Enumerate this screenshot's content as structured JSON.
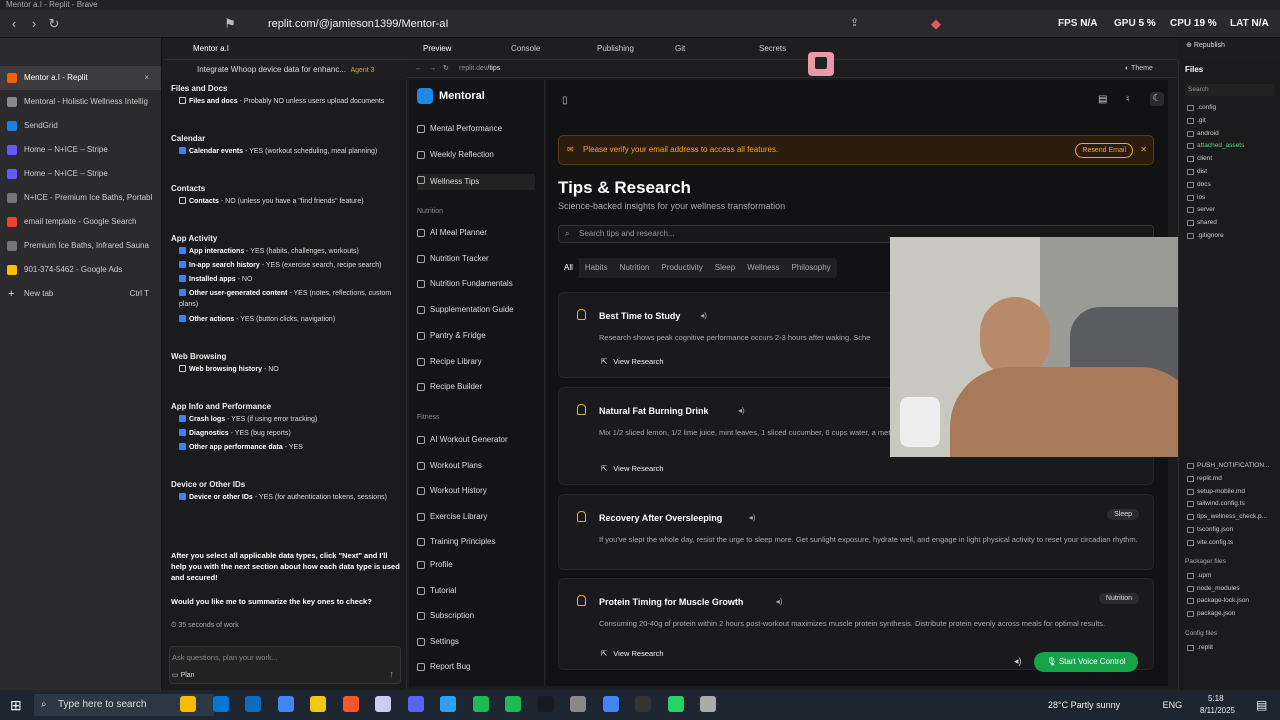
{
  "window": {
    "title": "Mentor a.I - Replit - Brave"
  },
  "browser": {
    "url": "replit.com/@jamieson1399/Mentor-aI",
    "stats": {
      "fps_label": "FPS",
      "fps": "N/A",
      "gpu_label": "GPU",
      "gpu": "5 %",
      "cpu_label": "CPU",
      "cpu": "19 %",
      "lat_label": "LAT",
      "lat": "N/A"
    }
  },
  "tabs": [
    {
      "label": "Mentor a.I - Replit",
      "color": "#f26207",
      "active": true
    },
    {
      "label": "Mentoral - Holistic Wellness Intellig",
      "color": "#888"
    },
    {
      "label": "SendGrid",
      "color": "#1a82e2"
    },
    {
      "label": "Home – N+ICE – Stripe",
      "color": "#635bff"
    },
    {
      "label": "Home – N+ICE – Stripe",
      "color": "#635bff"
    },
    {
      "label": "N+ICE - Premium Ice Baths, Portabl",
      "color": "#777"
    },
    {
      "label": "email template - Google Search",
      "color": "#ea4335"
    },
    {
      "label": "Premium Ice Baths, Infrared Sauna",
      "color": "#777"
    },
    {
      "label": "901-374-5462 - Google Ads",
      "color": "#fbbc04"
    }
  ],
  "new_tab": {
    "label": "New tab",
    "shortcut": "Ctrl T"
  },
  "chat": {
    "project": "Mentor a.I",
    "task": "Integrate Whoop device data for enhanc...",
    "agent": "Agent 3",
    "sections": [
      {
        "title": "Files and Docs",
        "items": [
          {
            "box": "empty",
            "bold": "Files and docs",
            "text": " - Probably NO unless users upload documents"
          }
        ]
      },
      {
        "title": "Calendar",
        "items": [
          {
            "box": "checked",
            "bold": "Calendar events",
            "text": " - YES (workout scheduling, meal planning)"
          }
        ]
      },
      {
        "title": "Contacts",
        "items": [
          {
            "box": "empty",
            "bold": "Contacts",
            "text": " - NO (unless you have a \"find friends\" feature)"
          }
        ]
      },
      {
        "title": "App Activity",
        "items": [
          {
            "box": "checked",
            "bold": "App interactions",
            "text": " - YES (habits, challenges, workouts)"
          },
          {
            "box": "checked",
            "bold": "In-app search history",
            "text": " - YES (exercise search, recipe search)"
          },
          {
            "box": "checked",
            "bold": "Installed apps",
            "text": " - NO"
          },
          {
            "box": "checked",
            "bold": "Other user-generated content",
            "text": " - YES (notes, reflections, custom plans)"
          },
          {
            "box": "checked",
            "bold": "Other actions",
            "text": " - YES (button clicks, navigation)"
          }
        ]
      },
      {
        "title": "Web Browsing",
        "items": [
          {
            "box": "empty",
            "bold": "Web browsing history",
            "text": " - NO"
          }
        ]
      },
      {
        "title": "App Info and Performance",
        "items": [
          {
            "box": "checked",
            "bold": "Crash logs",
            "text": " - YES (if using error tracking)"
          },
          {
            "box": "checked",
            "bold": "Diagnostics",
            "text": " - YES (bug reports)"
          },
          {
            "box": "checked",
            "bold": "Other app performance data",
            "text": " - YES"
          }
        ]
      },
      {
        "title": "Device or Other IDs",
        "items": [
          {
            "box": "checked",
            "bold": "Device or other IDs",
            "text": " - YES (for authentication tokens, sessions)"
          }
        ]
      }
    ],
    "closing": "After you select all applicable data types, click \"Next\" and I'll help you with the next section about how each data type is used and secured!",
    "question": "Would you like me to summarize the key ones to check?",
    "work": "35 seconds of work",
    "input_placeholder": "Ask questions, plan your work...",
    "mode": "Plan"
  },
  "workspace_tabs": [
    "Preview",
    "Console",
    "Publishing",
    "Git",
    "Secrets"
  ],
  "preview": {
    "path": "/tips",
    "host": "replit.dev",
    "theme": "Theme",
    "republish": "Republish"
  },
  "app": {
    "brand": "Mentoral",
    "nav_top": [
      "Mental Performance",
      "Weekly Reflection",
      "Wellness Tips"
    ],
    "section_nutrition": "Nutrition",
    "nav_nutrition": [
      "AI Meal Planner",
      "Nutrition Tracker",
      "Nutrition Fundamentals",
      "Supplementation Guide",
      "Pantry & Fridge",
      "Recipe Library",
      "Recipe Builder"
    ],
    "section_fitness": "Fitness",
    "nav_fitness": [
      "AI Workout Generator",
      "Workout Plans",
      "Workout History",
      "Exercise Library",
      "Training Principles"
    ],
    "nav_bottom": [
      "Profile",
      "Tutorial",
      "Subscription",
      "Settings",
      "Report Bug"
    ]
  },
  "main": {
    "banner": "Please verify your email address to access all features.",
    "resend": "Resend Email",
    "title": "Tips & Research",
    "subtitle": "Science-backed insights for your wellness transformation",
    "search_placeholder": "Search tips and research...",
    "filters": [
      "All",
      "Habits",
      "Nutrition",
      "Productivity",
      "Sleep",
      "Wellness",
      "Philosophy"
    ],
    "cards": [
      {
        "title": "Best Time to Study",
        "body": "Research shows peak cognitive performance occurs 2-3 hours after waking. Sche",
        "link": "View Research",
        "tag": ""
      },
      {
        "title": "Natural Fat Burning Drink",
        "body": "Mix 1/2 sliced lemon, 1/2 lime juice, mint leaves, 1 sliced cucumber, 6 cups water, a metabolism.",
        "link": "View Research",
        "tag": ""
      },
      {
        "title": "Recovery After Oversleeping",
        "body": "If you've slept the whole day, resist the urge to sleep more. Get sunlight exposure, hydrate well, and engage in light physical activity to reset your circadian rhythm.",
        "link": "",
        "tag": "Sleep"
      },
      {
        "title": "Protein Timing for Muscle Growth",
        "body": "Consuming 20-40g of protein within 2 hours post-workout maximizes muscle protein synthesis. Distribute protein evenly across meals for optimal results.",
        "link": "View Research",
        "tag": "Nutrition"
      }
    ],
    "voice": "Start Voice Control"
  },
  "files": {
    "title": "Files",
    "search": "Search",
    "top": [
      ".config",
      ".git",
      "android",
      "attached_assets",
      "client",
      "dist",
      "docs",
      "ios",
      "server",
      "shared",
      ".gitignore"
    ],
    "bottom": [
      "PUSH_NOTIFICATION...",
      "replit.md",
      "setup-mobile.md",
      "tailwind.config.ts",
      "tips_wellness_check.p...",
      "tsconfig.json",
      "vite.config.ts"
    ],
    "packager_title": "Packager files",
    "packager": [
      ".upm",
      "node_modules",
      "package-lock.json",
      "package.json"
    ],
    "config_title": "Config files",
    "config": [
      ".replit"
    ]
  },
  "taskbar": {
    "search": "Type here to search",
    "weather": "28°C  Partly sunny",
    "lang": "ENG",
    "time": "5:18 PM",
    "date": "8/11/2025"
  }
}
